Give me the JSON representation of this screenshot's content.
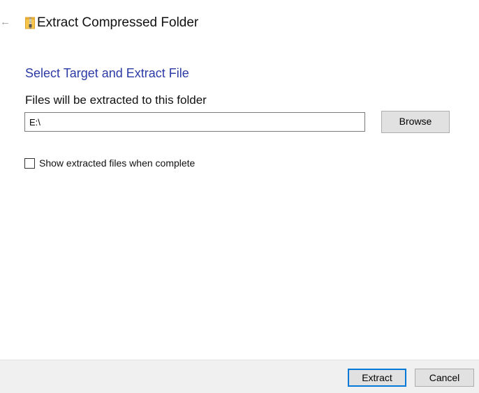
{
  "window": {
    "back_icon": "back-arrow-icon",
    "title_icon": "zip-folder-icon",
    "title": "Extract Compressed Folder"
  },
  "main": {
    "heading": "Select Target and Extract File",
    "path_label": "Files will be extracted to this folder",
    "path_value": "E:\\",
    "browse_label": "Browse",
    "show_files_label": "Show extracted files when complete",
    "show_files_checked": false
  },
  "footer": {
    "extract_label": "Extract",
    "cancel_label": "Cancel"
  },
  "colors": {
    "heading": "#2b3aa5",
    "focus_border": "#0078d7",
    "button_bg": "#e1e1e1",
    "footer_bg": "#f0f0f0"
  }
}
